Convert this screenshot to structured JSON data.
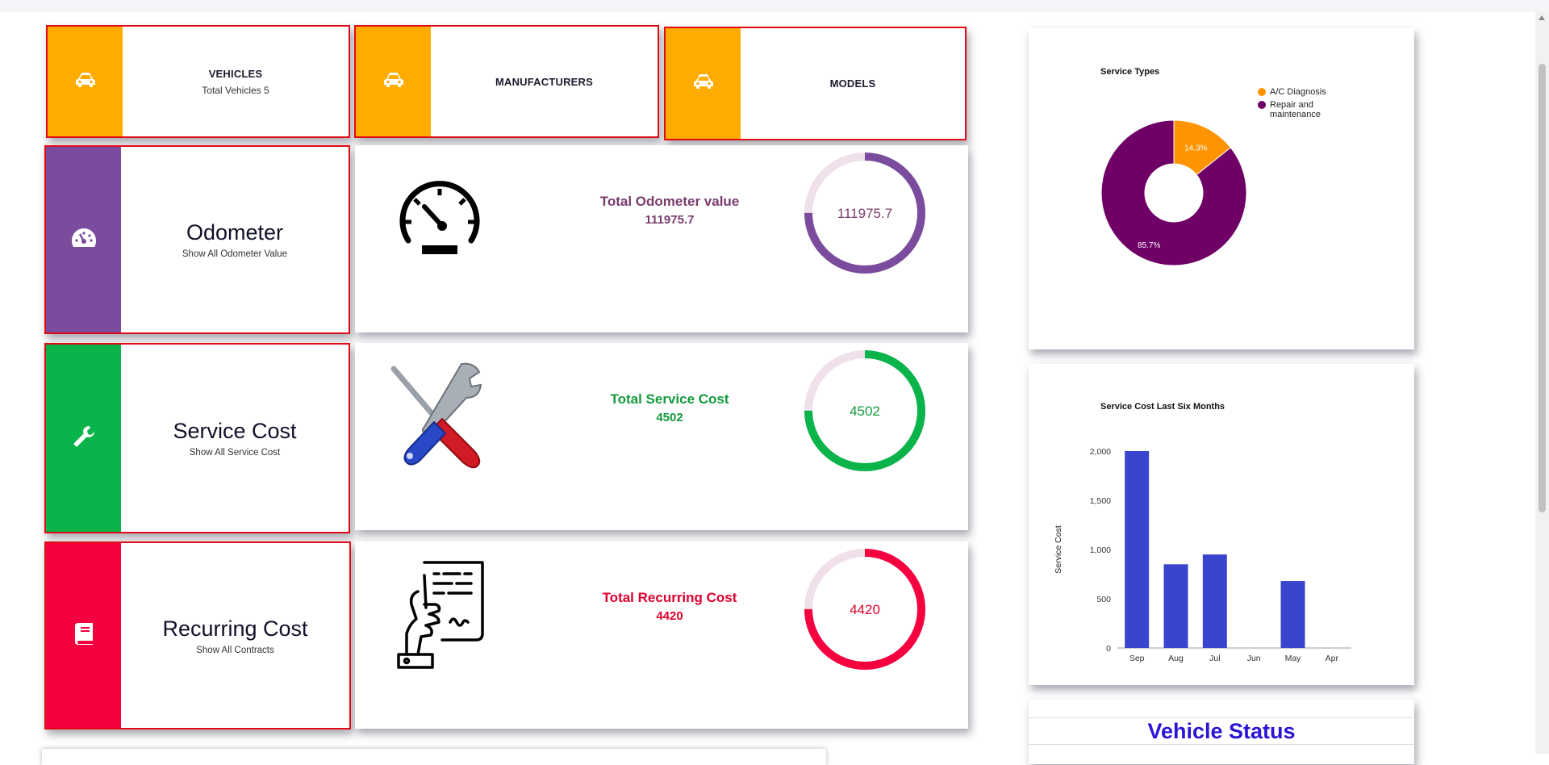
{
  "colors": {
    "amber": "#ffab00",
    "purple": "#7b4c9e",
    "green": "#0ab44a",
    "red": "#f5013f",
    "pie_orange": "#ff9400",
    "pie_purple": "#6e0066",
    "bar_blue": "#3b44ce",
    "odometer_text": "#7a3c6e",
    "service_text": "#119a3a",
    "recurring_text": "#e0002e",
    "ring_track": "#f0e0ea",
    "vehicle_status": "#2a14d6"
  },
  "cards": {
    "vehicles": {
      "title": "VEHICLES",
      "subtitle": "Total Vehicles 5",
      "icon": "car-icon"
    },
    "manufacturers": {
      "title": "MANUFACTURERS",
      "icon": "car-icon"
    },
    "models": {
      "title": "MODELS",
      "icon": "car-icon"
    },
    "odometer": {
      "title": "Odometer",
      "subtitle": "Show All Odometer Value",
      "icon": "speedometer-icon"
    },
    "service_cost": {
      "title": "Service Cost",
      "subtitle": "Show All Service Cost",
      "icon": "wrench-icon"
    },
    "recurring_cost": {
      "title": "Recurring Cost",
      "subtitle": "Show All Contracts",
      "icon": "book-icon"
    }
  },
  "totals": {
    "odometer": {
      "label": "Total Odometer value",
      "value": "111975.7",
      "ring_value": "111975.7",
      "ring_fraction": 0.75,
      "icon": "speedometer-large-icon"
    },
    "service": {
      "label": "Total Service Cost",
      "value": "4502",
      "ring_value": "4502",
      "ring_fraction": 0.75,
      "icon": "tools-icon"
    },
    "recurring": {
      "label": "Total Recurring Cost",
      "value": "4420",
      "ring_value": "4420",
      "ring_fraction": 0.75,
      "icon": "contract-icon"
    }
  },
  "vehicle_status": {
    "title": "Vehicle Status"
  },
  "chart_data": [
    {
      "type": "pie",
      "title": "Service Types",
      "donut": true,
      "labels": [
        "A/C Diagnosis",
        "Repair and maintenance"
      ],
      "values": [
        14.3,
        85.7
      ],
      "data_labels": [
        "14.3%",
        "85.7%"
      ],
      "legend": "top-right"
    },
    {
      "type": "bar",
      "title": "Service Cost Last Six Months",
      "categories": [
        "Sep",
        "Aug",
        "Jul",
        "Jun",
        "May",
        "Apr"
      ],
      "values": [
        2000,
        850,
        950,
        0,
        680,
        0
      ],
      "ylabel": "Service Cost",
      "xlabel": "",
      "ylim": [
        0,
        2000
      ],
      "yticks": [
        "0",
        "500",
        "1,000",
        "1,500",
        "2,000"
      ],
      "grid": false
    }
  ]
}
